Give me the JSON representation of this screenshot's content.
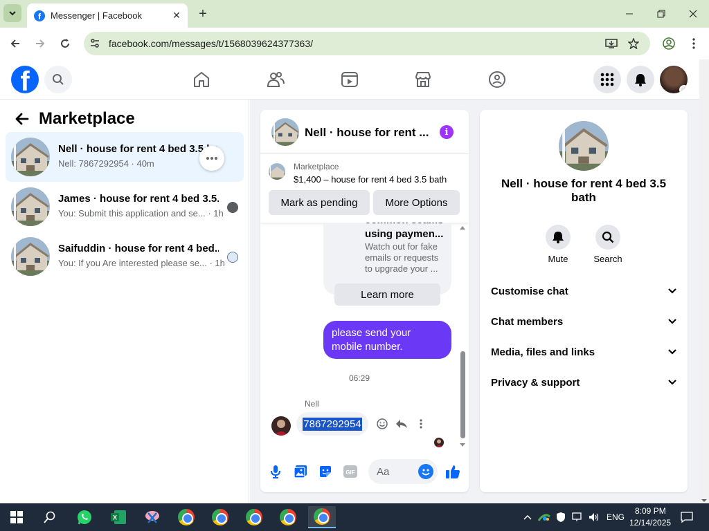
{
  "browser": {
    "tab_title": "Messenger | Facebook",
    "url": "facebook.com/messages/t/1568039624377363/"
  },
  "left": {
    "title": "Marketplace",
    "conversations": [
      {
        "name": "Nell · house for rent 4 bed 3.5 bath",
        "sub": "Nell: 7867292954 · 40m"
      },
      {
        "name": "James · house for rent 4 bed 3.5...",
        "sub": "You: Submit this application and se... · 1h"
      },
      {
        "name": "Saifuddin · house for rent 4 bed...",
        "sub": "You: If you Are interested please se... · 1h"
      }
    ]
  },
  "chat": {
    "title": "Nell · house for rent ...",
    "listing_label": "Marketplace",
    "listing_desc": "$1,400 – house for rent 4 bed 3.5 bath",
    "btn_pending": "Mark as pending",
    "btn_more": "More Options",
    "card_title": "common scams using paymen...",
    "card_desc": "Watch out for fake emails or requests to upgrade your ...",
    "learn_more": "Learn more",
    "outgoing_msg": "please send your mobile number.",
    "timestamp": "06:29",
    "sender": "Nell",
    "incoming_msg": "7867292954",
    "composer_placeholder": "Aa",
    "composer_icons": [
      "mic-icon",
      "photo-icon",
      "sticker-icon",
      "gif-icon",
      "emoji-icon",
      "like-icon"
    ]
  },
  "right": {
    "name": "Nell · house for rent 4 bed 3.5 bath",
    "mute": "Mute",
    "search": "Search",
    "sections": [
      "Customise chat",
      "Chat members",
      "Media, files and links",
      "Privacy & support"
    ]
  },
  "taskbar": {
    "lang": "ENG",
    "time": "8:09 PM",
    "date": "12/14/2025"
  },
  "colors": {
    "fb_blue": "#0866ff",
    "outgoing_bubble": "#6b38f5",
    "chrome_frame": "#d9e9cf",
    "active_conv": "#ebf5ff"
  }
}
